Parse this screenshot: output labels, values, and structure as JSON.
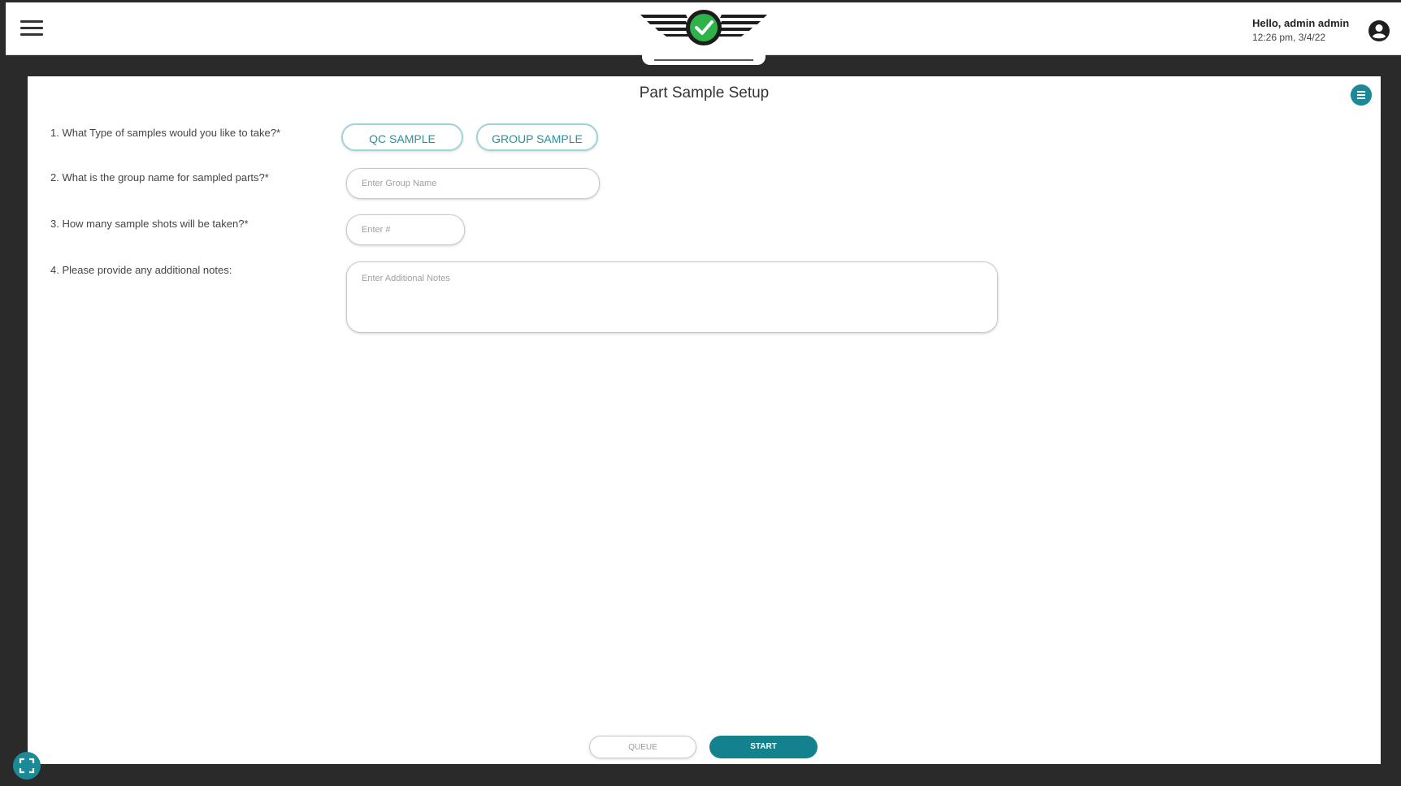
{
  "header": {
    "user_greeting": "Hello, admin admin",
    "timestamp": "12:26 pm, 3/4/22"
  },
  "page": {
    "title": "Part Sample Setup"
  },
  "form": {
    "q1_label": "1. What Type of samples would you like to take?*",
    "q1_options": [
      "QC SAMPLE",
      "GROUP SAMPLE"
    ],
    "q2_label": "2. What is the group name for sampled parts?*",
    "q2_placeholder": "Enter Group Name",
    "q3_label": "3. How many sample shots will be taken?*",
    "q3_placeholder": "Enter #",
    "q4_label": "4. Please provide any additional notes:",
    "q4_placeholder": "Enter Additional Notes"
  },
  "actions": {
    "queue_label": "QUEUE",
    "start_label": "START"
  },
  "colors": {
    "accent": "#14828e",
    "pill_border": "#9fd3d9",
    "logo_green": "#2fb24a"
  },
  "icons": {
    "menu": "hamburger-menu-icon",
    "logo": "winged-check-logo-icon",
    "account": "account-circle-icon",
    "list": "list-icon",
    "fullscreen": "fullscreen-icon"
  }
}
